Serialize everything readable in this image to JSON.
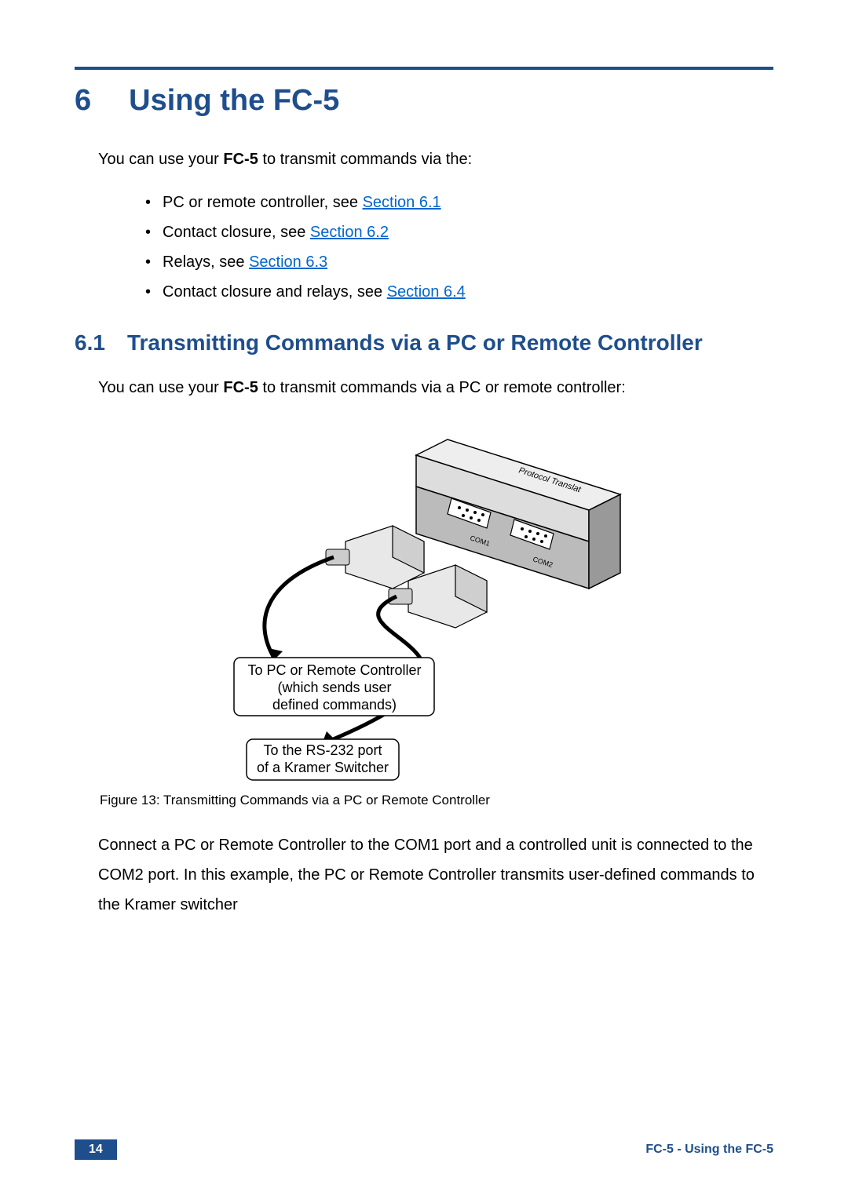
{
  "section": {
    "number": "6",
    "title": "Using the FC-5",
    "intro_prefix": "You can use your ",
    "intro_bold": "FC-5",
    "intro_suffix": " to transmit commands via the:",
    "bullets": [
      {
        "text": "PC or remote controller, see ",
        "link": "Section 6.1"
      },
      {
        "text": "Contact closure, see ",
        "link": "Section 6.2"
      },
      {
        "text": "Relays, see ",
        "link": "Section 6.3"
      },
      {
        "text": "Contact closure and relays, see ",
        "link": "Section 6.4"
      }
    ]
  },
  "subsection": {
    "number": "6.1",
    "title": "Transmitting Commands via a PC or Remote Controller",
    "intro_prefix": "You can use your ",
    "intro_bold": "FC-5",
    "intro_suffix": " to transmit commands via a PC or remote controller:"
  },
  "figure": {
    "device_label": "Protocol Translat",
    "port1_label": "COM1",
    "port2_label": "COM2",
    "callout1_line1": "To PC or Remote Controller",
    "callout1_line2": "(which sends user",
    "callout1_line3": "defined commands)",
    "callout2_line1": "To the RS-232 port",
    "callout2_line2": "of a Kramer Switcher",
    "caption": "Figure 13: Transmitting Commands via a PC or Remote Controller"
  },
  "paragraph": "Connect a PC or Remote Controller to the COM1 port and a controlled unit is connected to the COM2 port. In this example, the PC or Remote Controller transmits user-defined commands to the Kramer switcher",
  "footer": {
    "page_number": "14",
    "right": "FC-5 - Using the FC-5"
  }
}
